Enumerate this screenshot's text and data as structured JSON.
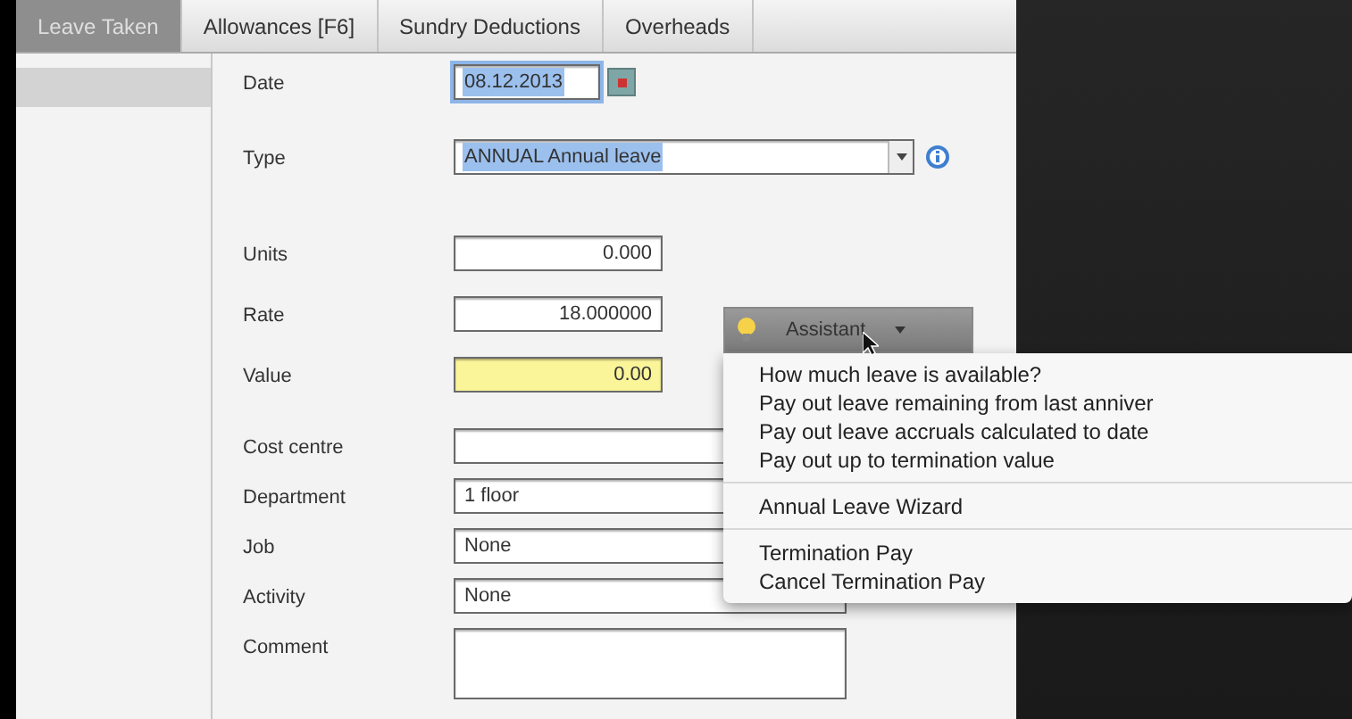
{
  "tabs": [
    {
      "label": "Leave Taken",
      "selected": true
    },
    {
      "label": "Allowances [F6]",
      "selected": false
    },
    {
      "label": "Sundry Deductions",
      "selected": false
    },
    {
      "label": "Overheads",
      "selected": false
    }
  ],
  "form": {
    "sections": [
      [
        {
          "kind": "date",
          "label": "Date",
          "value": "08.12.2013",
          "text_selected": true,
          "highlighted": false
        },
        {
          "kind": "select",
          "label": "Type",
          "value": "ANNUAL Annual leave",
          "text_selected": true,
          "highlighted": false
        }
      ],
      [
        {
          "kind": "number",
          "label": "Units",
          "value": "0.000",
          "highlighted": false
        },
        {
          "kind": "number",
          "label": "Rate",
          "value": "18.000000",
          "highlighted": false
        },
        {
          "kind": "number",
          "label": "Value",
          "value": "0.00",
          "highlighted": true
        }
      ],
      [
        {
          "kind": "text",
          "label": "Cost centre",
          "highlighted": false
        },
        {
          "kind": "text",
          "label": "Department",
          "value": "1 floor",
          "highlighted": false
        },
        {
          "kind": "text",
          "label": "Job",
          "value": "None",
          "highlighted": false
        },
        {
          "kind": "text",
          "label": "Activity",
          "value": "None",
          "highlighted": false
        },
        {
          "kind": "memo",
          "label": "Comment",
          "highlighted": false
        }
      ]
    ]
  },
  "assistant": {
    "label": "Assistant",
    "expanded": true,
    "menu": [
      [
        "How much leave is available?",
        "Pay out leave remaining from last anniver",
        "Pay out leave accruals calculated to date",
        "Pay out up to termination value"
      ],
      [
        "Annual Leave Wizard"
      ],
      [
        "Termination Pay",
        "Cancel Termination Pay"
      ]
    ]
  }
}
